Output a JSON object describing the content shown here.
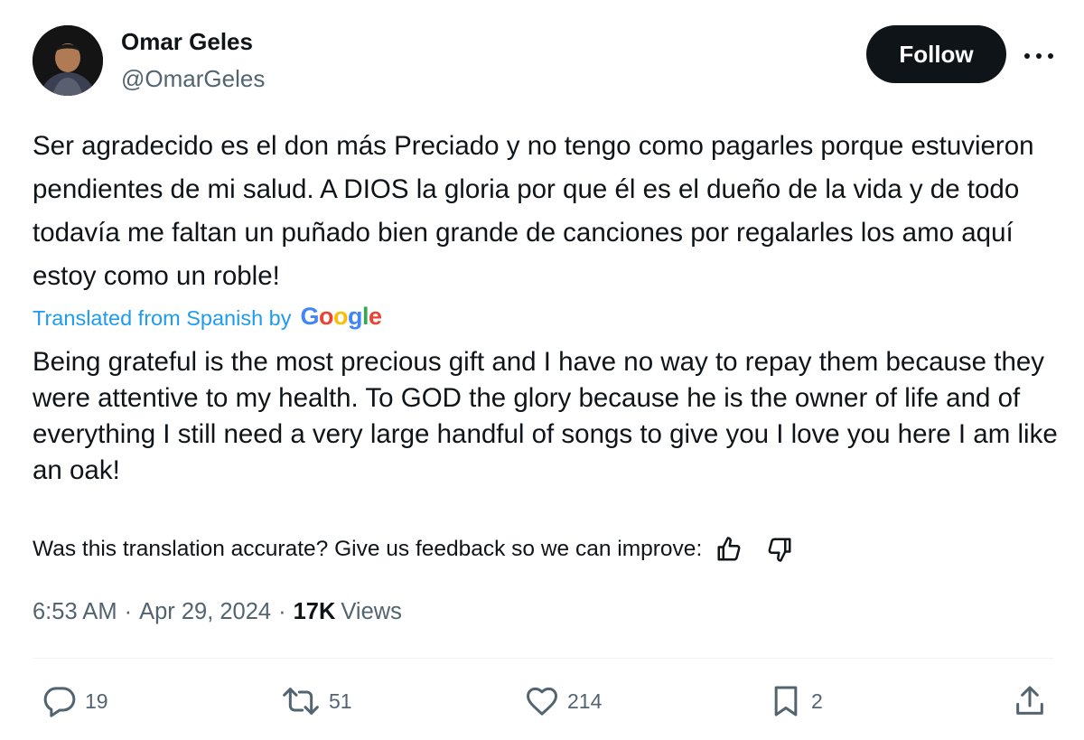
{
  "author": {
    "name": "Omar Geles",
    "handle": "@OmarGeles"
  },
  "follow_label": "Follow",
  "tweet": {
    "text": "Ser agradecido es el don más Preciado y no tengo como pagarles porque estuvieron pendientes de mi salud. A DIOS la gloria por que él es el dueño de la vida y de todo todavía me faltan un puñado bien grande de canciones por regalarles los amo aquí estoy como un roble!",
    "translated_label": "Translated from Spanish by",
    "translation": "Being grateful is the most precious gift and I have no way to repay them because they were attentive to my health. To GOD the glory because he is the owner of life and of everything I still need a very large handful of songs to give you I love you here I am like an oak!",
    "feedback_prompt": "Was this translation accurate? Give us feedback so we can improve:"
  },
  "meta": {
    "time": "6:53 AM",
    "separator": "·",
    "date": "Apr 29, 2024",
    "views_count": "17K",
    "views_label": "Views"
  },
  "actions": {
    "replies": "19",
    "reposts": "51",
    "likes": "214",
    "bookmarks": "2"
  },
  "icons": [
    "avatar",
    "more-icon",
    "google-logo",
    "thumbs-up-icon",
    "thumbs-down-icon",
    "reply-icon",
    "repost-icon",
    "like-icon",
    "bookmark-icon",
    "share-icon"
  ],
  "colors": {
    "text": "#0f1419",
    "secondary": "#536471",
    "link": "#1d9bf0",
    "button_bg": "#0f1419",
    "button_text": "#ffffff"
  }
}
